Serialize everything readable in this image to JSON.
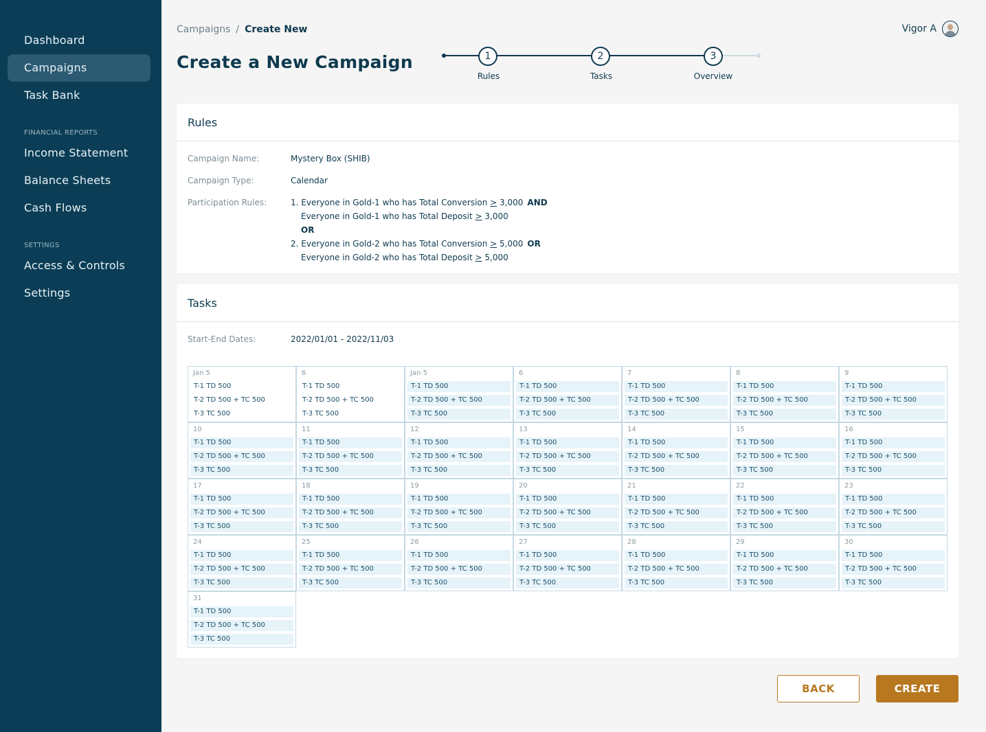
{
  "sidebar": {
    "items": [
      {
        "label": "Dashboard"
      },
      {
        "label": "Campaigns"
      },
      {
        "label": "Task Bank"
      },
      {
        "label": "Income Statement"
      },
      {
        "label": "Balance Sheets"
      },
      {
        "label": "Cash Flows"
      },
      {
        "label": "Access & Controls"
      },
      {
        "label": "Settings"
      }
    ],
    "sections": {
      "financial": "FINANCIAL REPORTS",
      "settings": "SETTINGS"
    },
    "active_item": "Campaigns"
  },
  "breadcrumb": {
    "parent": "Campaigns",
    "separator": "/",
    "current": "Create New"
  },
  "page_title": "Create a New Campaign",
  "user": {
    "name": "Vigor A",
    "avatar_icon": "user-avatar"
  },
  "stepper": {
    "steps": [
      {
        "number": "1",
        "label": "Rules"
      },
      {
        "number": "2",
        "label": "Tasks"
      },
      {
        "number": "3",
        "label": "Overview"
      }
    ],
    "current_step": 3
  },
  "rules": {
    "title": "Rules",
    "campaign_name_label": "Campaign Name:",
    "campaign_name": "Mystery Box (SHIB)",
    "campaign_type_label": "Campaign Type:",
    "campaign_type": "Calendar",
    "participation_label": "Participation Rules:",
    "lines": [
      {
        "prefix": "1. Everyone in Gold-1 who has Total Conversion ",
        "ge": ">",
        "value": " 3,000",
        "op": "AND"
      },
      {
        "prefix": "Everyone in Gold-1 who has Total Deposit ",
        "ge": ">",
        "value": " 3,000",
        "op": ""
      },
      {
        "prefix": "",
        "ge": "",
        "value": "",
        "op": "OR"
      },
      {
        "prefix": "2. Everyone in Gold-2 who has Total Conversion ",
        "ge": ">",
        "value": " 5,000",
        "op": "OR"
      },
      {
        "prefix": "Everyone in Gold-2 who has Total Deposit ",
        "ge": ">",
        "value": " 5,000",
        "op": ""
      }
    ]
  },
  "tasks": {
    "title": "Tasks",
    "dates_label": "Start-End Dates:",
    "dates": "2022/01/01  -  2022/11/03",
    "task_labels": [
      "T-1  TD 500",
      "T-2  TD 500 + TC 500",
      "T-3  TC 500"
    ],
    "days": [
      {
        "label": "Jan 5",
        "highlight": false
      },
      {
        "label": "6",
        "highlight": false
      },
      {
        "label": "Jan 5",
        "highlight": true
      },
      {
        "label": "6",
        "highlight": true
      },
      {
        "label": "7",
        "highlight": true
      },
      {
        "label": "8",
        "highlight": true
      },
      {
        "label": "9",
        "highlight": true
      },
      {
        "label": "10",
        "highlight": true
      },
      {
        "label": "11",
        "highlight": true
      },
      {
        "label": "12",
        "highlight": true
      },
      {
        "label": "13",
        "highlight": true
      },
      {
        "label": "14",
        "highlight": true
      },
      {
        "label": "15",
        "highlight": true
      },
      {
        "label": "16",
        "highlight": true
      },
      {
        "label": "17",
        "highlight": true
      },
      {
        "label": "18",
        "highlight": true
      },
      {
        "label": "19",
        "highlight": true
      },
      {
        "label": "20",
        "highlight": true
      },
      {
        "label": "21",
        "highlight": true
      },
      {
        "label": "22",
        "highlight": true
      },
      {
        "label": "23",
        "highlight": true
      },
      {
        "label": "24",
        "highlight": true
      },
      {
        "label": "25",
        "highlight": true
      },
      {
        "label": "26",
        "highlight": true
      },
      {
        "label": "27",
        "highlight": true
      },
      {
        "label": "28",
        "highlight": true
      },
      {
        "label": "29",
        "highlight": true
      },
      {
        "label": "30",
        "highlight": true
      },
      {
        "label": "31",
        "highlight": true
      }
    ]
  },
  "buttons": {
    "back": "BACK",
    "create": "CREATE"
  },
  "colors": {
    "sidebar": "#0b3e56",
    "accent": "#b8781f",
    "text": "#0f3a4f"
  }
}
